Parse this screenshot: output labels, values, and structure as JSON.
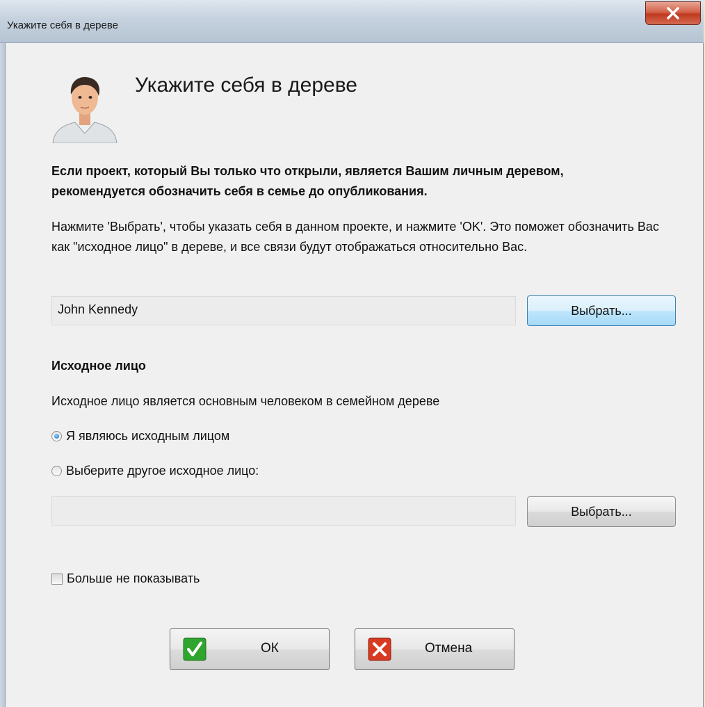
{
  "window": {
    "title": "Укажите себя в дереве",
    "close_icon": "close-icon"
  },
  "header": {
    "title": "Укажите себя в дереве",
    "avatar_icon": "person-avatar"
  },
  "intro": {
    "bold": "Если проект, который Вы только что открыли, является Вашим личным деревом, рекомендуется обозначить себя в семье до опубликования.",
    "normal": "Нажмите 'Выбрать', чтобы указать себя в данном проекте, и нажмите 'OK'. Это поможет обозначить Вас как \"исходное лицо\" в дереве, и все связи будут отображаться относительно Вас."
  },
  "self_select": {
    "value": "John Kennedy",
    "button_label": "Выбрать..."
  },
  "root_person": {
    "section_title": "Исходное лицо",
    "description": "Исходное лицо является основным человеком в семейном дереве",
    "options": [
      {
        "label": "Я являюсь исходным лицом",
        "checked": true
      },
      {
        "label": "Выберите другое исходное лицо:",
        "checked": false
      }
    ],
    "other_value": "",
    "other_button_label": "Выбрать..."
  },
  "dont_show": {
    "label": "Больше не показывать",
    "checked": false
  },
  "footer": {
    "ok_label": "ОК",
    "cancel_label": "Отмена"
  },
  "colors": {
    "ok_icon": "#2fa52f",
    "cancel_icon": "#d93a22",
    "accent": "#3c7fb1"
  }
}
